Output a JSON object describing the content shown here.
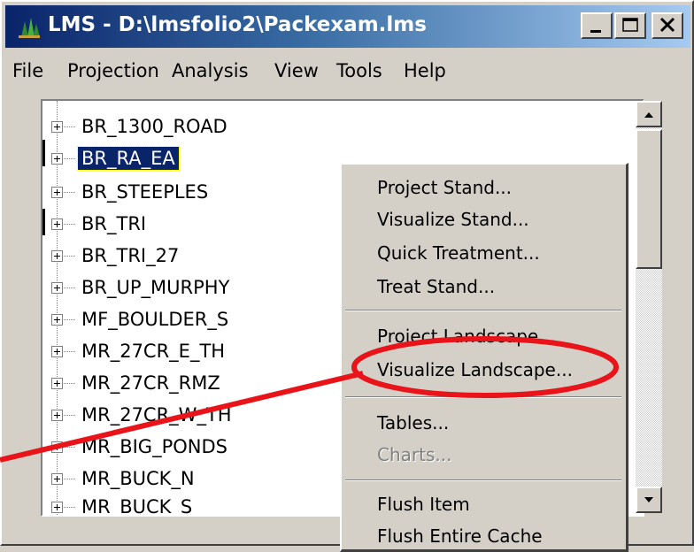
{
  "window": {
    "title": "LMS - D:\\lmsfolio2\\Packexam.lms",
    "controls": [
      "minimize",
      "maximize",
      "close"
    ]
  },
  "menubar": {
    "items": [
      "File",
      "Projection",
      "Analysis",
      "View",
      "Tools",
      "Help"
    ]
  },
  "tree": {
    "items": [
      {
        "label": "BR_1300_ROAD",
        "selected": false
      },
      {
        "label": "BR_RA_EA",
        "selected": true
      },
      {
        "label": "BR_STEEPLES",
        "selected": false
      },
      {
        "label": "BR_TRI",
        "selected": false
      },
      {
        "label": "BR_TRI_27",
        "selected": false
      },
      {
        "label": "BR_UP_MURPHY",
        "selected": false
      },
      {
        "label": "MF_BOULDER_S",
        "selected": false
      },
      {
        "label": "MR_27CR_E_TH",
        "selected": false
      },
      {
        "label": "MR_27CR_RMZ",
        "selected": false
      },
      {
        "label": "MR_27CR_W_TH",
        "selected": false
      },
      {
        "label": "MR_BIG_PONDS",
        "selected": false
      },
      {
        "label": "MR_BUCK_N",
        "selected": false
      },
      {
        "label": "MR_BUCK_S",
        "selected": false
      }
    ]
  },
  "context_menu": {
    "items": [
      {
        "label": "Project Stand...",
        "enabled": true
      },
      {
        "label": "Visualize Stand...",
        "enabled": true
      },
      {
        "label": "Quick Treatment...",
        "enabled": true
      },
      {
        "label": "Treat Stand...",
        "enabled": true
      },
      {
        "label": "Project Landscape...",
        "enabled": true
      },
      {
        "label": "Visualize Landscape...",
        "enabled": true,
        "highlighted_by_annotation": true
      },
      {
        "label": "Tables...",
        "enabled": true
      },
      {
        "label": "Charts...",
        "enabled": false
      },
      {
        "label": "Flush Item",
        "enabled": true
      },
      {
        "label": "Flush Entire Cache",
        "enabled": true
      }
    ]
  },
  "annotation": {
    "color": "#e8141a",
    "shape": "ellipse-with-arrow",
    "target": "Visualize Landscape..."
  }
}
